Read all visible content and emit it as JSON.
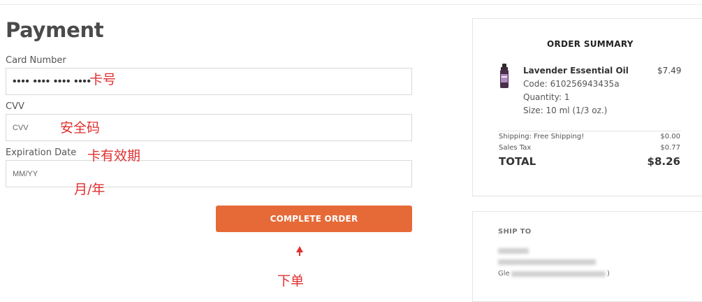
{
  "payment": {
    "title": "Payment",
    "card_number": {
      "label": "Card Number",
      "value": "•••• •••• •••• ••••",
      "annotation": "卡号"
    },
    "cvv": {
      "label": "CVV",
      "placeholder": "CVV",
      "annotation": "安全码"
    },
    "expiration": {
      "label": "Expiration Date",
      "placeholder": "MM/YY",
      "annotation": "卡有效期",
      "annotation_format": "月/年"
    },
    "complete_button": {
      "label": "COMPLETE ORDER",
      "annotation": "下单"
    }
  },
  "order_summary": {
    "title": "ORDER SUMMARY",
    "item": {
      "name": "Lavender Essential Oil",
      "price": "$7.49",
      "code": "Code: 610256943435a",
      "quantity": "Quantity: 1",
      "size": "Size: 10 ml (1/3 oz.)"
    },
    "shipping": {
      "label": "Shipping: Free Shipping!",
      "value": "$0.00"
    },
    "tax": {
      "label": "Sales Tax",
      "value": "$0.77"
    },
    "total": {
      "label": "TOTAL",
      "value": "$8.26"
    }
  },
  "ship_to": {
    "title": "SHIP TO",
    "address_prefix": "Gle",
    "address_suffix": ")"
  },
  "colors": {
    "accent": "#e66a38",
    "annotation": "#e03030"
  },
  "icons": {
    "product_thumb": "essential-oil-bottle",
    "arrow": "arrow-up-icon"
  }
}
